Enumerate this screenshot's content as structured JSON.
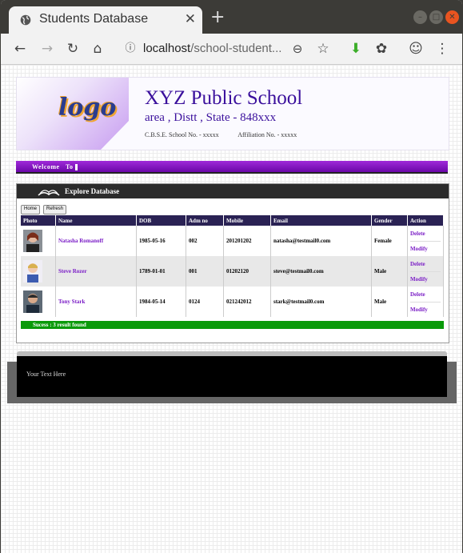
{
  "browser": {
    "tab_title": "Students Database",
    "url_host": "localhost",
    "url_path": "/school-student..."
  },
  "header": {
    "logo_text": "logo",
    "school_name": "XYZ Public School",
    "address": "area , Distt , State - 848xxx",
    "cbse": "C.B.S.E. School No. - xxxxx",
    "affiliation": "Affiliation No. - xxxxx"
  },
  "welcome": {
    "text": "Welcome   To"
  },
  "panel": {
    "title": "Explore Database",
    "home_label": "Home",
    "refresh_label": "Refresh",
    "columns": [
      "Photo",
      "Name",
      "DOB",
      "Adm no",
      "Mobile",
      "Email",
      "Gender",
      "Action"
    ],
    "rows": [
      {
        "name": "Natasha Romanoff",
        "dob": "1985-05-16",
        "adm": "002",
        "mobile": "201201202",
        "email": "natasha@testmail0.com",
        "gender": "Female"
      },
      {
        "name": "Steve Rozer",
        "dob": "1789-01-01",
        "adm": "001",
        "mobile": "01202120",
        "email": "steve@testmail0.com",
        "gender": "Male"
      },
      {
        "name": "Tony Stark",
        "dob": "1984-05-14",
        "adm": "0124",
        "mobile": "021242012",
        "email": "stark@testmail0.com",
        "gender": "Male"
      }
    ],
    "delete_label": "Delete",
    "modify_label": "Modify",
    "status": "Sucess : 3 result found"
  },
  "footer": {
    "text": "Your Text Here"
  },
  "colors": {
    "accent": "#7a1cc6",
    "title": "#3a0f9c",
    "table_head": "#2a2254",
    "success": "#0a9a0a"
  }
}
